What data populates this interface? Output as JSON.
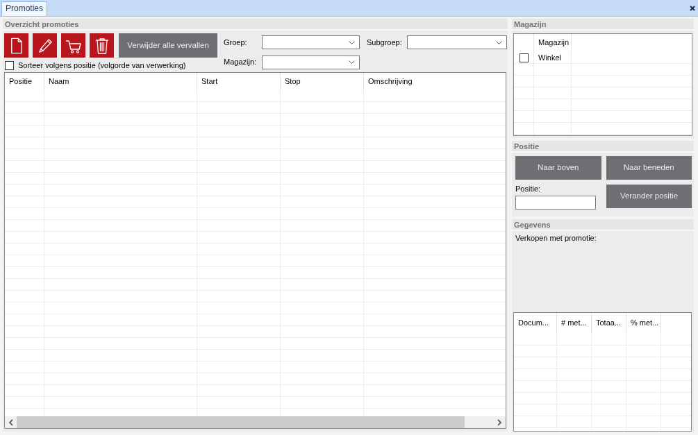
{
  "tabs": [
    {
      "label": "Promoties",
      "selected": true
    }
  ],
  "overview": {
    "title": "Overzicht promoties",
    "action_button": "Verwijder alle vervallen",
    "filters": [
      {
        "label": "Groep:"
      },
      {
        "label": "Subgroep:"
      },
      {
        "label": "Magazijn:"
      }
    ],
    "sort_option": {
      "label": "Sorteer volgens positie (volgorde van verwerking)",
      "checked": false
    },
    "table": {
      "columns": [
        "Positie",
        "Naam",
        "Start",
        "Stop",
        "Omschrijving"
      ]
    }
  },
  "warehouse": {
    "title": "Magazijn",
    "columns": [
      "Magazijn"
    ],
    "rows": [
      {
        "name": "Winkel",
        "checked": false
      }
    ]
  },
  "position": {
    "title": "Positie",
    "move_up_button": "Naar boven",
    "move_down_button": "Naar beneden",
    "field_label": "Positie:",
    "change_button": "Verander positie"
  },
  "details": {
    "title": "Gegevens",
    "label": "Verkopen met promotie:",
    "table": {
      "columns": [
        "Docum...",
        "# met...",
        "Totaa...",
        "% met..."
      ]
    }
  }
}
